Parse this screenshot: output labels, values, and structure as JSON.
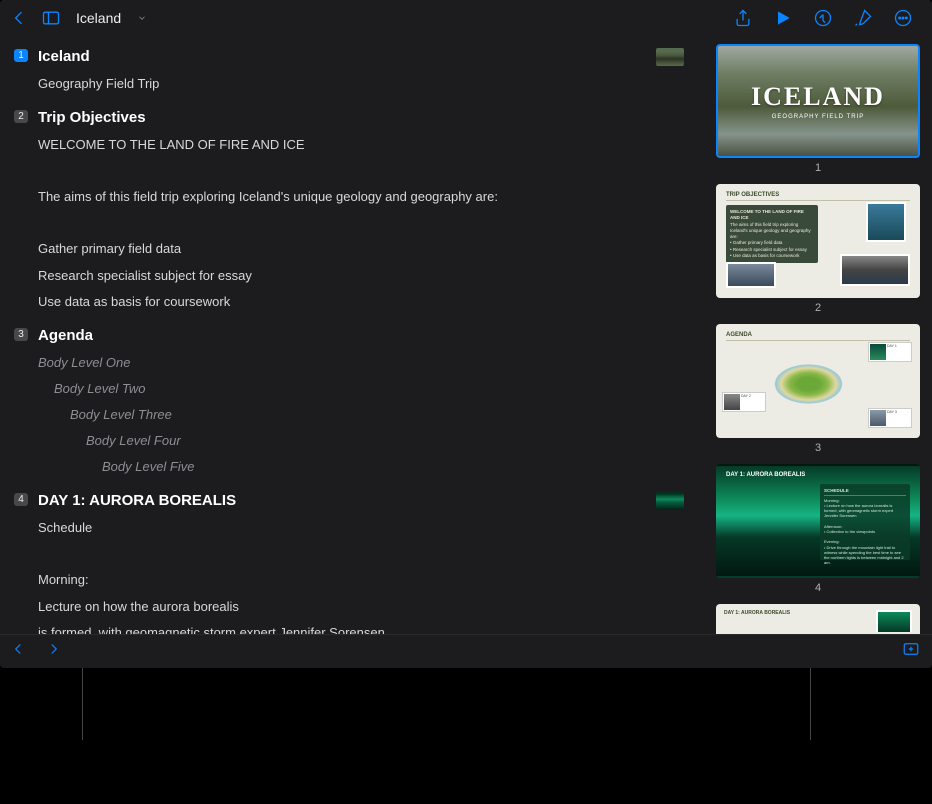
{
  "toolbar": {
    "doc_title": "Iceland"
  },
  "outline": [
    {
      "num": "1",
      "current": true,
      "title": "Iceland",
      "thumb": "mt1",
      "lines": [
        {
          "text": "Geography Field Trip"
        }
      ]
    },
    {
      "num": "2",
      "title": "Trip Objectives",
      "lines": [
        {
          "text": "WELCOME TO THE LAND OF FIRE AND ICE"
        },
        {
          "text": ""
        },
        {
          "text": "The aims of this field trip exploring Iceland's unique geology and geography are:"
        },
        {
          "text": ""
        },
        {
          "text": "Gather primary field data"
        },
        {
          "text": "Research specialist subject for essay"
        },
        {
          "text": "Use data as basis for coursework"
        }
      ]
    },
    {
      "num": "3",
      "title": "Agenda",
      "lines": [
        {
          "text": "Body Level One",
          "placeholder": true,
          "indent": 0
        },
        {
          "text": "Body Level Two",
          "placeholder": true,
          "indent": 1
        },
        {
          "text": "Body Level Three",
          "placeholder": true,
          "indent": 2
        },
        {
          "text": "Body Level Four",
          "placeholder": true,
          "indent": 3
        },
        {
          "text": "Body Level Five",
          "placeholder": true,
          "indent": 4
        }
      ]
    },
    {
      "num": "4",
      "title": "DAY 1: AURORA BOREALIS",
      "thumb": "mt4",
      "lines": [
        {
          "text": "Schedule"
        },
        {
          "text": ""
        },
        {
          "text": "Morning:"
        },
        {
          "text": "Lecture on how the aurora borealis"
        },
        {
          "text": "is formed, with geomagnetic storm expert Jennifer Sorensen"
        }
      ]
    }
  ],
  "nav": {
    "s1": {
      "num": "1",
      "title": "ICELAND",
      "sub": "GEOGRAPHY FIELD TRIP"
    },
    "s2": {
      "num": "2",
      "title": "TRIP OBJECTIVES",
      "box_hd": "WELCOME TO THE LAND OF FIRE AND ICE",
      "box_body": "The aims of this field trip exploring Iceland's unique geology and geography are:\n• Gather primary field data\n• Research specialist subject for essay\n• Use data as basis for coursework"
    },
    "s3": {
      "num": "3",
      "title": "AGENDA",
      "d1": "DAY 1",
      "d2": "DAY 2",
      "d3": "DAY 3"
    },
    "s4": {
      "num": "4",
      "title": "DAY 1: AURORA BOREALIS",
      "box_hd": "SCHEDULE"
    },
    "s5": {
      "title": "DAY 1: AURORA BOREALIS"
    }
  }
}
